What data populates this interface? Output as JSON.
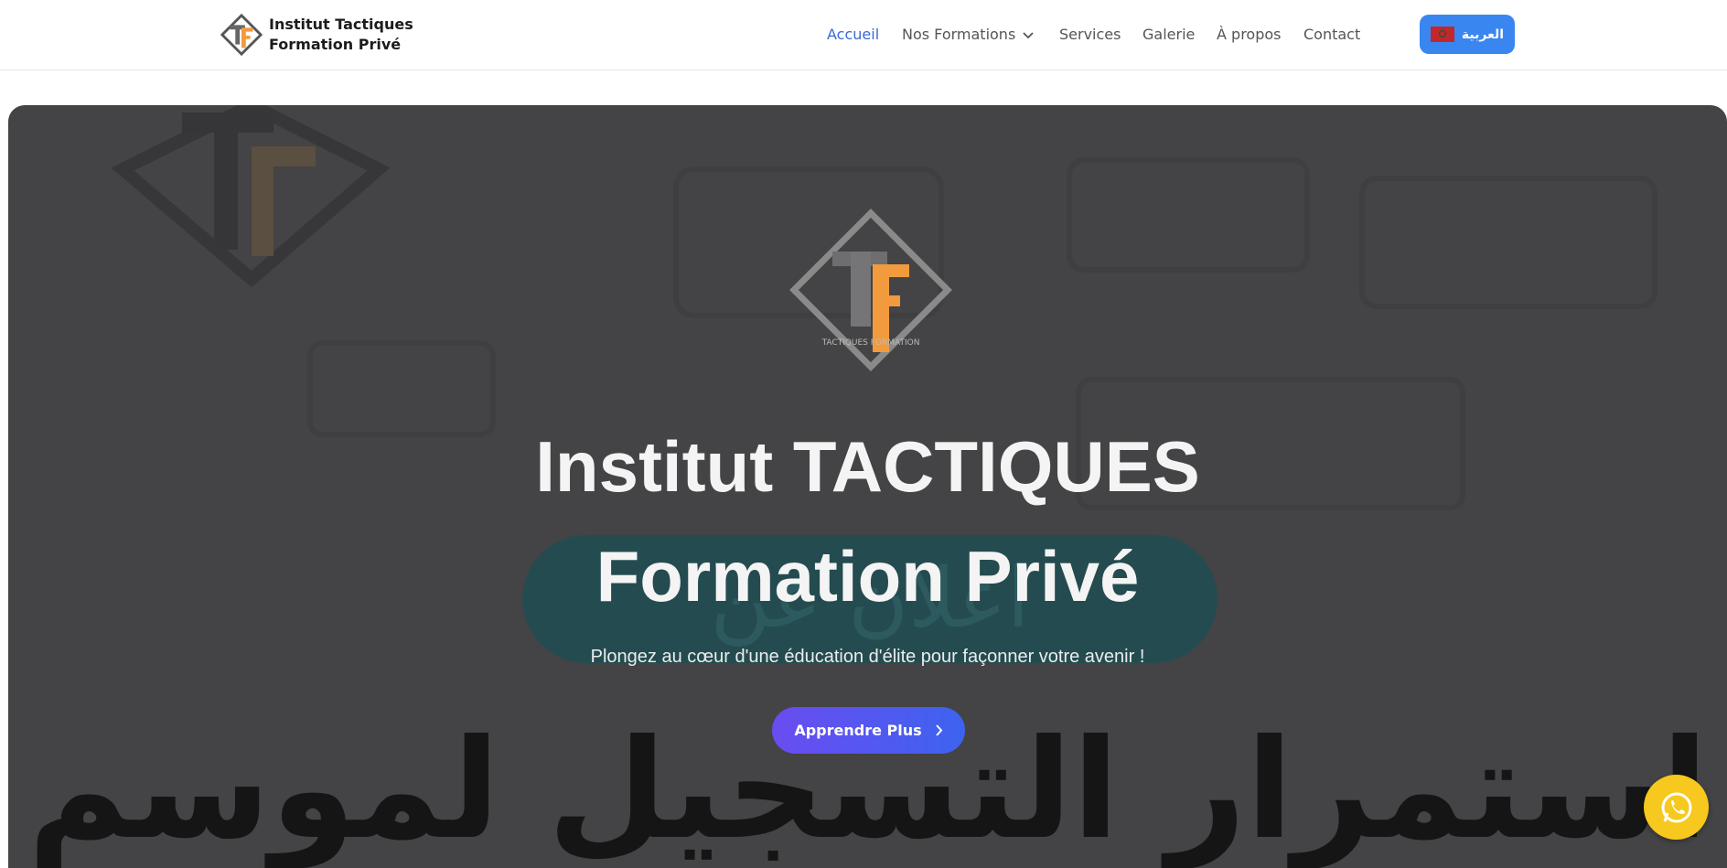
{
  "brand": {
    "line1": "Institut Tactiques",
    "line2": "Formation Privé"
  },
  "nav": {
    "items": [
      {
        "label": "Accueil",
        "active": true
      },
      {
        "label": "Nos Formations",
        "dropdown": true
      },
      {
        "label": "Services"
      },
      {
        "label": "Galerie"
      },
      {
        "label": "À propos"
      },
      {
        "label": "Contact"
      }
    ],
    "language_button": "العربية"
  },
  "hero": {
    "title_line1": "Institut TACTIQUES",
    "title_line2": "Formation Privé",
    "subtitle": "Plongez au cœur d'une éducation d'élite pour façonner votre avenir !",
    "cta_label": "Apprendre Plus",
    "background_text_1": "اعلان عن",
    "background_text_2": "استمرار التسجيل لموسم",
    "logo_ring_text": "TACTIQUES FORMATION"
  },
  "colors": {
    "accent": "#3a6ad0",
    "language_button": "#3a86f0",
    "hero_overlay": "#444345",
    "cta_gradient_start": "#6a4cf0",
    "cta_gradient_end": "#3d63ef",
    "whatsapp": "#f7c81d",
    "logo_orange": "#f29a3e"
  },
  "icons": {
    "dropdown": "chevron-down-icon",
    "cta": "chevron-right-icon",
    "language": "morocco-flag-icon",
    "chat": "whatsapp-icon"
  }
}
